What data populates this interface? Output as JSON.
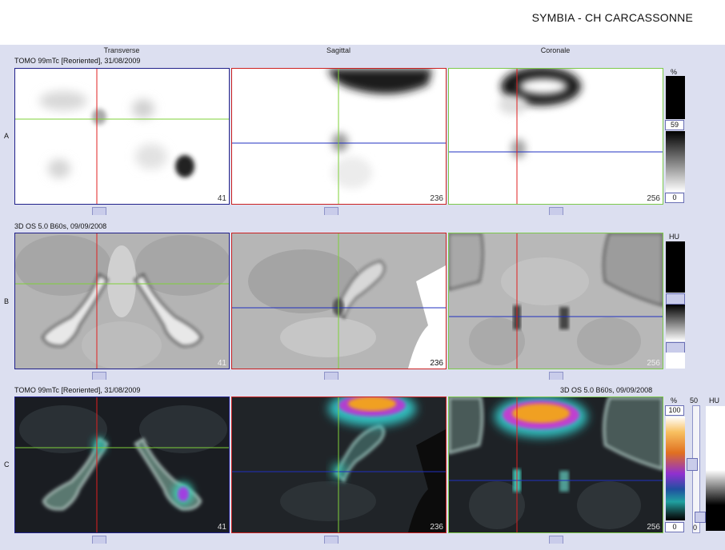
{
  "header": {
    "title": "SYMBIA - CH CARCASSONNE"
  },
  "columns": [
    "Transverse",
    "Sagittal",
    "Coronale"
  ],
  "rows": [
    {
      "letter": "A",
      "info_left": "TOMO 99mTc [Reoriented], 31/08/2009",
      "info_right": "",
      "slices": [
        "41",
        "236",
        "256"
      ]
    },
    {
      "letter": "B",
      "info_left": "3D  OS  5.0  B60s, 09/09/2008",
      "info_right": "",
      "slices": [
        "41",
        "236",
        "256"
      ]
    },
    {
      "letter": "C",
      "info_left": "TOMO 99mTc [Reoriented], 31/08/2009",
      "info_right": "3D  OS  5.0  B60s, 09/09/2008",
      "slices": [
        "41",
        "236",
        "256"
      ]
    }
  ],
  "scales": {
    "a": {
      "unit": "%",
      "mid": "59",
      "low": "0"
    },
    "b": {
      "unit": "HU"
    },
    "c": {
      "unit": "%",
      "top": "100",
      "low": "0",
      "slider_label": "50",
      "unit2": "HU",
      "low2": "0"
    }
  },
  "colors": {
    "crosshair_red": "#e02020",
    "crosshair_green": "#7fd03a",
    "crosshair_blue": "#2030c0",
    "frame_blue": "#20208a",
    "frame_red": "#cc2020",
    "frame_green": "#7cc94a",
    "panel_bg": "#dcdff0"
  }
}
